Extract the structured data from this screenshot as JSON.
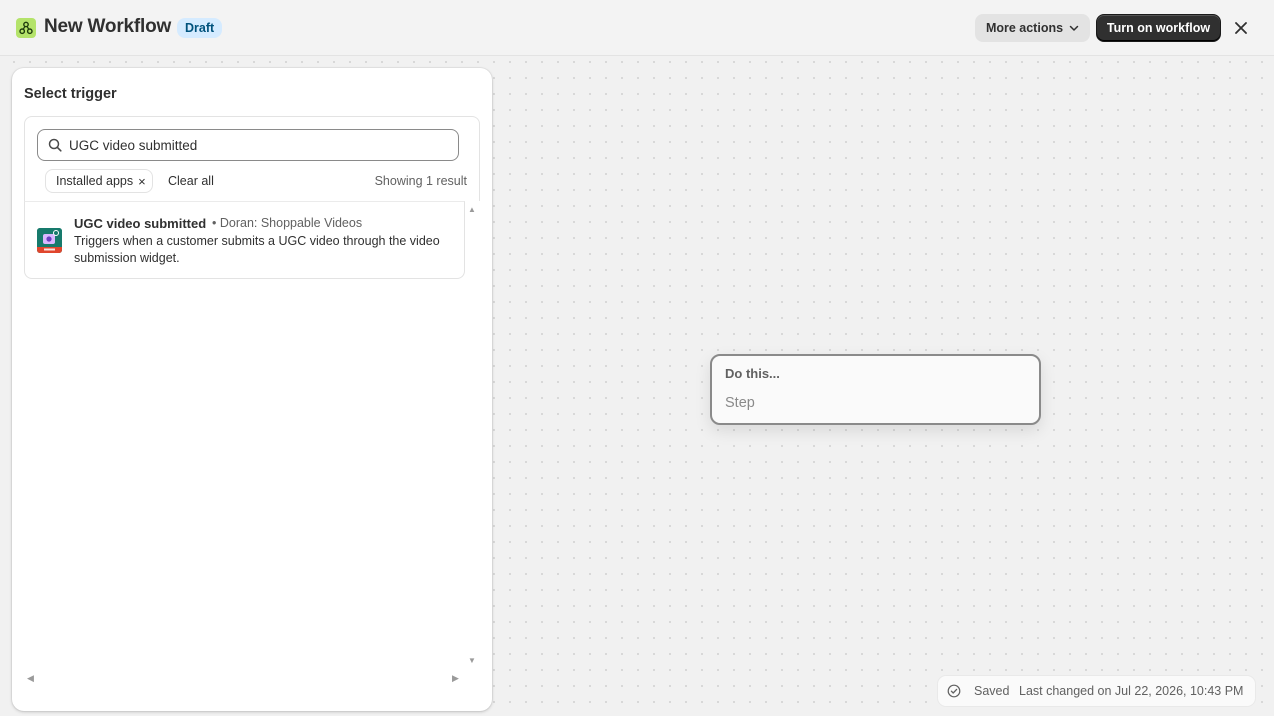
{
  "header": {
    "title": "New Workflow",
    "status_badge": "Draft",
    "more_actions_label": "More actions",
    "turn_on_label": "Turn on workflow",
    "app_icon": "workflow-icon",
    "close_icon": "close-icon"
  },
  "trigger_panel": {
    "title": "Select trigger",
    "search": {
      "value": "UGC video submitted",
      "icon": "search-icon"
    },
    "filters": [
      {
        "label": "Installed apps",
        "remove_glyph": "×"
      }
    ],
    "clear_all_label": "Clear all",
    "result_count": "Showing 1 result",
    "results": [
      {
        "title": "UGC video submitted",
        "source": "• Doran: Shoppable Videos",
        "description": "Triggers when a customer submits a UGC video through the video submission widget.",
        "icon": "doran-app-icon"
      }
    ]
  },
  "canvas": {
    "step_node": {
      "heading": "Do this...",
      "placeholder": "Step"
    }
  },
  "status": {
    "saved_label": "Saved",
    "last_changed": "Last changed on Jul 22, 2026, 10:43 PM",
    "icon": "check-circle-icon"
  },
  "colors": {
    "primary_button": "#303030",
    "badge_bg": "#d5ebff",
    "badge_text": "#00527c",
    "app_icon_bg": "#b4e36a"
  }
}
